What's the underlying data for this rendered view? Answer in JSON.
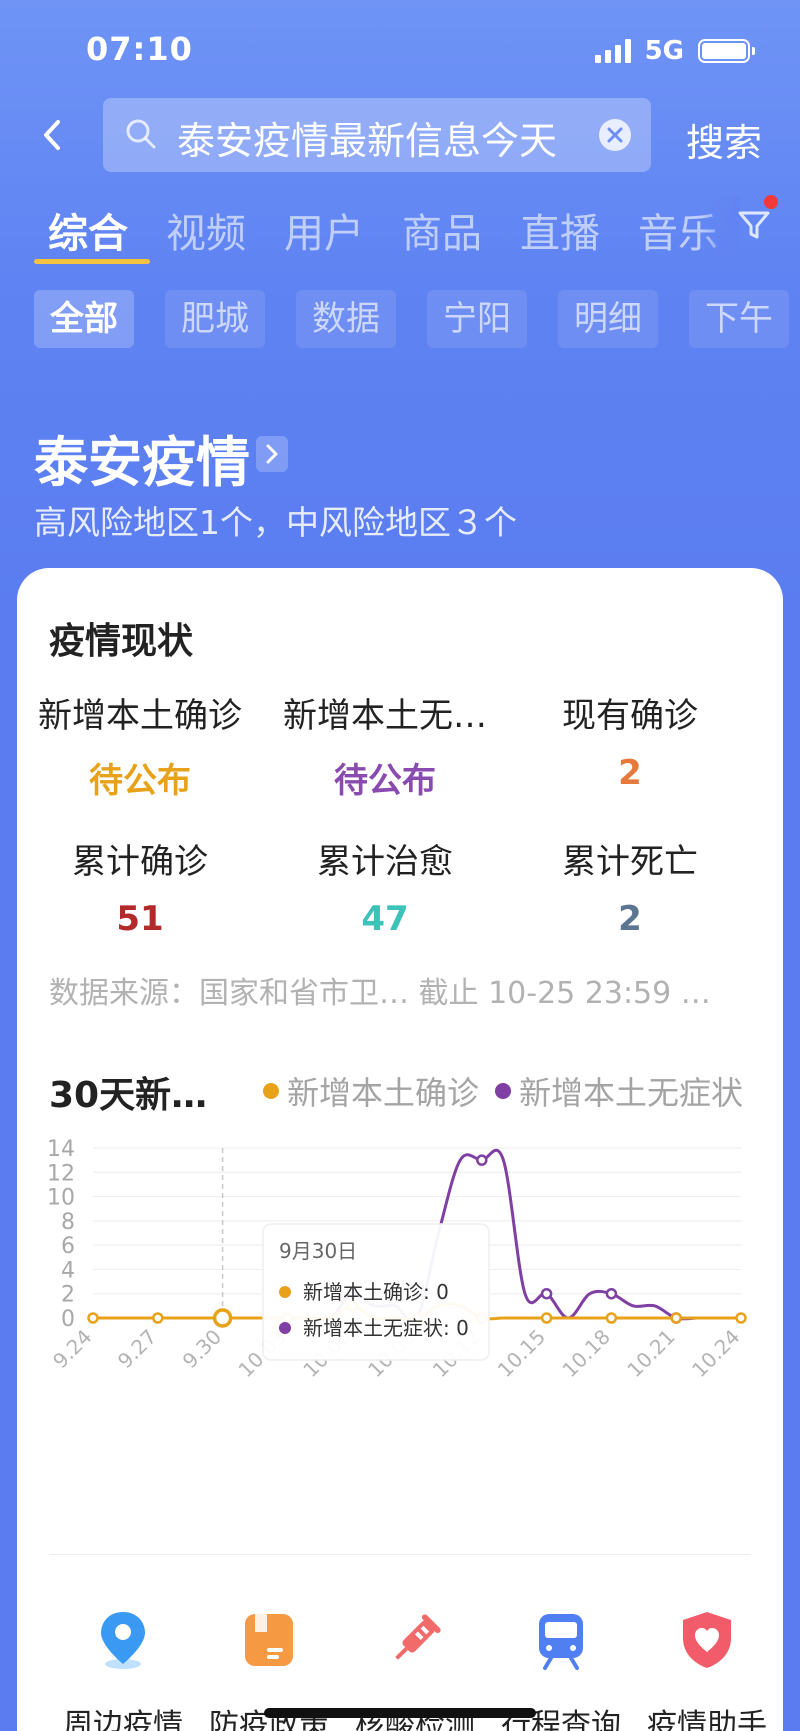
{
  "status_bar": {
    "time": "07:10",
    "network": "5G"
  },
  "search": {
    "query": "泰安疫情最新信息今天",
    "button": "搜索"
  },
  "tabs": [
    {
      "label": "综合",
      "active": true
    },
    {
      "label": "视频"
    },
    {
      "label": "用户"
    },
    {
      "label": "商品"
    },
    {
      "label": "直播"
    },
    {
      "label": "音乐"
    }
  ],
  "chips": [
    {
      "label": "全部",
      "active": true
    },
    {
      "label": "肥城"
    },
    {
      "label": "数据"
    },
    {
      "label": "宁阳"
    },
    {
      "label": "明细"
    },
    {
      "label": "下午"
    }
  ],
  "hero": {
    "title": "泰安疫情",
    "subtitle": "高风险地区1个，中风险地区３个"
  },
  "card": {
    "title": "疫情现状",
    "stats": [
      {
        "label": "新增本土确诊",
        "value": "待公布",
        "color": "#e8a21a"
      },
      {
        "label": "新增本土无…",
        "value": "待公布",
        "color": "#8a4bb0"
      },
      {
        "label": "现有确诊",
        "value": "2",
        "color": "#e67a3c"
      },
      {
        "label": "累计确诊",
        "value": "51",
        "color": "#b22a2a"
      },
      {
        "label": "累计治愈",
        "value": "47",
        "color": "#3cc2b8"
      },
      {
        "label": "累计死亡",
        "value": "2",
        "color": "#5a7690"
      }
    ],
    "source": "数据来源：国家和省市卫…  截止 10-25 23:59 …",
    "chart_title": "30天新…",
    "legend": [
      {
        "name": "新增本土确诊",
        "color": "#e8a21a"
      },
      {
        "name": "新增本土无症状",
        "color": "#7f3fa3"
      }
    ],
    "tooltip": {
      "date": "9月30日",
      "line1": "新增本土确诊: 0",
      "line2": "新增本土无症状: 0"
    }
  },
  "chart_data": {
    "type": "line",
    "x": [
      "9.24",
      "9.25",
      "9.26",
      "9.27",
      "9.28",
      "9.29",
      "9.30",
      "10.01",
      "10.02",
      "10.03",
      "10.04",
      "10.05",
      "10.06",
      "10.07",
      "10.08",
      "10.09",
      "10.10",
      "10.11",
      "10.12",
      "10.13",
      "10.14",
      "10.15",
      "10.16",
      "10.17",
      "10.18",
      "10.19",
      "10.20",
      "10.21",
      "10.22",
      "10.23",
      "10.24"
    ],
    "x_tick_labels": [
      "9.24",
      "9.27",
      "9.30",
      "10.03",
      "10.06",
      "10.09",
      "10.12",
      "10.15",
      "10.18",
      "10.21",
      "10.24"
    ],
    "series": [
      {
        "name": "新增本土确诊",
        "color": "#e8a21a",
        "values": [
          0,
          0,
          0,
          0,
          0,
          0,
          0,
          0,
          0,
          0,
          0,
          0,
          1,
          0,
          0,
          0,
          1,
          1,
          0,
          0,
          0,
          0,
          0,
          0,
          0,
          0,
          0,
          0,
          0,
          0,
          0
        ]
      },
      {
        "name": "新增本土无症状",
        "color": "#7f3fa3",
        "values": [
          0,
          0,
          0,
          0,
          0,
          0,
          0,
          0,
          0,
          0,
          0,
          0,
          2,
          1,
          1,
          0,
          7,
          13,
          13,
          13,
          2,
          2,
          0,
          2,
          2,
          1,
          1,
          0,
          0,
          0,
          0
        ]
      }
    ],
    "ylim": [
      0,
      14
    ],
    "y_ticks": [
      0,
      2,
      4,
      6,
      8,
      10,
      12,
      14
    ],
    "highlight_x": "9.30",
    "grid": true
  },
  "shortcuts": [
    {
      "label": "周边疫情",
      "icon": "location-pin-icon"
    },
    {
      "label": "防疫政策",
      "icon": "policy-book-icon"
    },
    {
      "label": "核酸检测",
      "icon": "syringe-icon"
    },
    {
      "label": "行程查询",
      "icon": "train-icon"
    },
    {
      "label": "疫情助手",
      "icon": "shield-heart-icon"
    }
  ]
}
